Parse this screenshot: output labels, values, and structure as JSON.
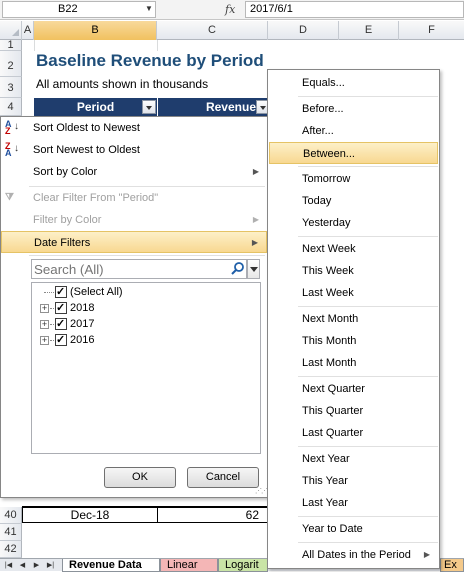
{
  "formula_bar": {
    "name_box": "B22",
    "formula": "2017/6/1"
  },
  "columns": [
    "A",
    "B",
    "C",
    "D",
    "E",
    "F"
  ],
  "rows": {
    "top": [
      "1",
      "2",
      "3",
      "4"
    ],
    "bottom": [
      "40",
      "41",
      "42"
    ]
  },
  "sheet": {
    "title": "Baseline Revenue by Period",
    "subtitle": "All amounts shown in thousands",
    "header_period": "Period",
    "header_revenue": "Revenue",
    "row40_period": "Dec-18",
    "row40_revenue": "62"
  },
  "filter_menu": {
    "items": [
      {
        "label": "Sort Oldest to Newest",
        "icon": "sort-ascending-icon",
        "enabled": true
      },
      {
        "label": "Sort Newest to Oldest",
        "icon": "sort-descending-icon",
        "enabled": true
      },
      {
        "label": "Sort by Color",
        "enabled": true,
        "submenu": true
      },
      {
        "label": "Clear Filter From \"Period\"",
        "icon": "clear-filter-icon",
        "enabled": false
      },
      {
        "label": "Filter by Color",
        "enabled": false,
        "submenu": true
      },
      {
        "label": "Date Filters",
        "enabled": true,
        "submenu": true,
        "highlighted": true
      }
    ],
    "search_placeholder": "Search (All)",
    "tree": [
      {
        "label": "(Select All)",
        "checked": true
      },
      {
        "label": "2018",
        "checked": true
      },
      {
        "label": "2017",
        "checked": true
      },
      {
        "label": "2016",
        "checked": true
      }
    ],
    "ok_label": "OK",
    "cancel_label": "Cancel"
  },
  "date_filters_submenu": {
    "items": [
      "Equals...",
      "Before...",
      "After...",
      "Between...",
      "Tomorrow",
      "Today",
      "Yesterday",
      "Next Week",
      "This Week",
      "Last Week",
      "Next Month",
      "This Month",
      "Last Month",
      "Next Quarter",
      "This Quarter",
      "Last Quarter",
      "Next Year",
      "This Year",
      "Last Year",
      "Year to Date",
      "All Dates in the Period"
    ],
    "highlighted": "Between..."
  },
  "sheet_tabs": [
    {
      "label": "Revenue Data",
      "active": true,
      "color": "#ffffff"
    },
    {
      "label": "Linear",
      "active": false,
      "color": "#f4b6b6"
    },
    {
      "label": "Logarit",
      "active": false,
      "color": "#c9e4a6"
    },
    {
      "label": "Ex",
      "active": false,
      "color": "#f4c98a"
    }
  ],
  "colors": {
    "header_fill": "#1f3d6d",
    "title": "#1f4e79",
    "highlight": "#f8d891"
  }
}
